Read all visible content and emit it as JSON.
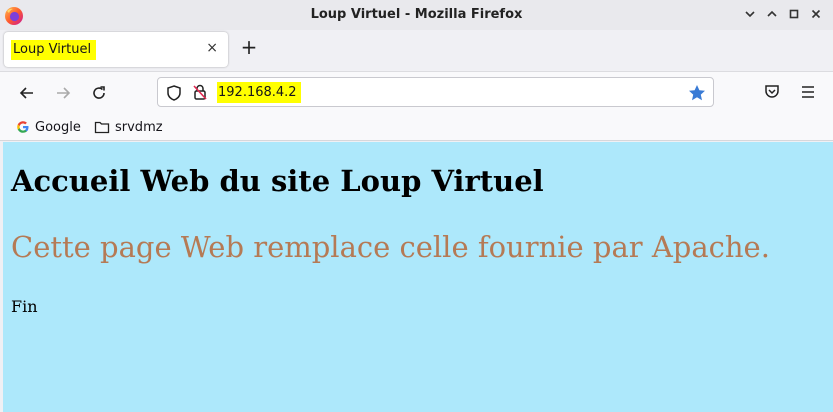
{
  "window": {
    "title": "Loup Virtuel - Mozilla Firefox",
    "controls": [
      "minimize",
      "maximize",
      "close"
    ]
  },
  "tabs": [
    {
      "label": "Loup Virtuel",
      "active": true
    }
  ],
  "toolbar": {
    "url": "192.168.4.2",
    "new_tab_symbol": "+",
    "close_tab_symbol": "×"
  },
  "bookmarks": [
    {
      "label": "Google",
      "icon": "google-icon"
    },
    {
      "label": "srvdmz",
      "icon": "folder-icon"
    }
  ],
  "page": {
    "heading": "Accueil Web du site Loup Virtuel",
    "subtitle": "Cette page Web remplace celle fournie par Apache.",
    "footer": "Fin"
  },
  "colors": {
    "page_background": "#ade8fb",
    "subtitle_color": "#b57a55",
    "highlight": "#ffff00",
    "bookmark_star": "#0061e0"
  }
}
